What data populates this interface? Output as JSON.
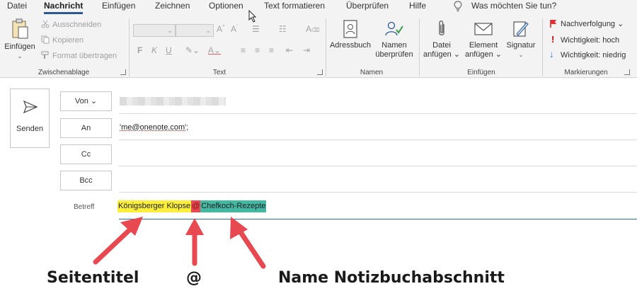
{
  "tabs": [
    {
      "label": "Datei"
    },
    {
      "label": "Nachricht"
    },
    {
      "label": "Einfügen"
    },
    {
      "label": "Zeichnen"
    },
    {
      "label": "Optionen"
    },
    {
      "label": "Text formatieren"
    },
    {
      "label": "Überprüfen"
    },
    {
      "label": "Hilfe"
    }
  ],
  "tell_me": "Was möchten Sie tun?",
  "ribbon": {
    "clipboard": {
      "paste": "Einfügen",
      "cut": "Ausschneiden",
      "copy": "Kopieren",
      "format_painter": "Format übertragen",
      "group_label": "Zwischenablage"
    },
    "text": {
      "group_label": "Text",
      "bold": "F",
      "italic": "K",
      "underline": "U"
    },
    "names": {
      "address_book": "Adressbuch",
      "check_names_1": "Namen",
      "check_names_2": "überprüfen",
      "group_label": "Namen"
    },
    "insert": {
      "file_1": "Datei",
      "file_2": "anfügen",
      "item_1": "Element",
      "item_2": "anfügen",
      "signature": "Signatur",
      "group_label": "Einfügen"
    },
    "tags": {
      "follow_up": "Nachverfolgung",
      "high": "Wichtigkeit: hoch",
      "low": "Wichtigkeit: niedrig",
      "group_label": "Markierungen"
    }
  },
  "compose": {
    "send": "Senden",
    "from_btn": "Von",
    "to_btn": "An",
    "cc_btn": "Cc",
    "bcc_btn": "Bcc",
    "to_value": "'me@onenote.com'",
    "to_suffix": ";",
    "subject_label": "Betreff",
    "subject_page_title": "Königsberger Klopse",
    "subject_at": "@",
    "subject_section": "Chefkoch-Rezepte"
  },
  "annotations": {
    "page_title": "Seitentitel",
    "at": "@",
    "section_name": "Name Notizbuchabschnitt"
  },
  "colors": {
    "highlight_yellow": "#fcef3c",
    "highlight_red": "#e8484f",
    "highlight_teal": "#44b8a3",
    "arrow_red": "#e8484f",
    "accent_blue": "#2b579a"
  }
}
